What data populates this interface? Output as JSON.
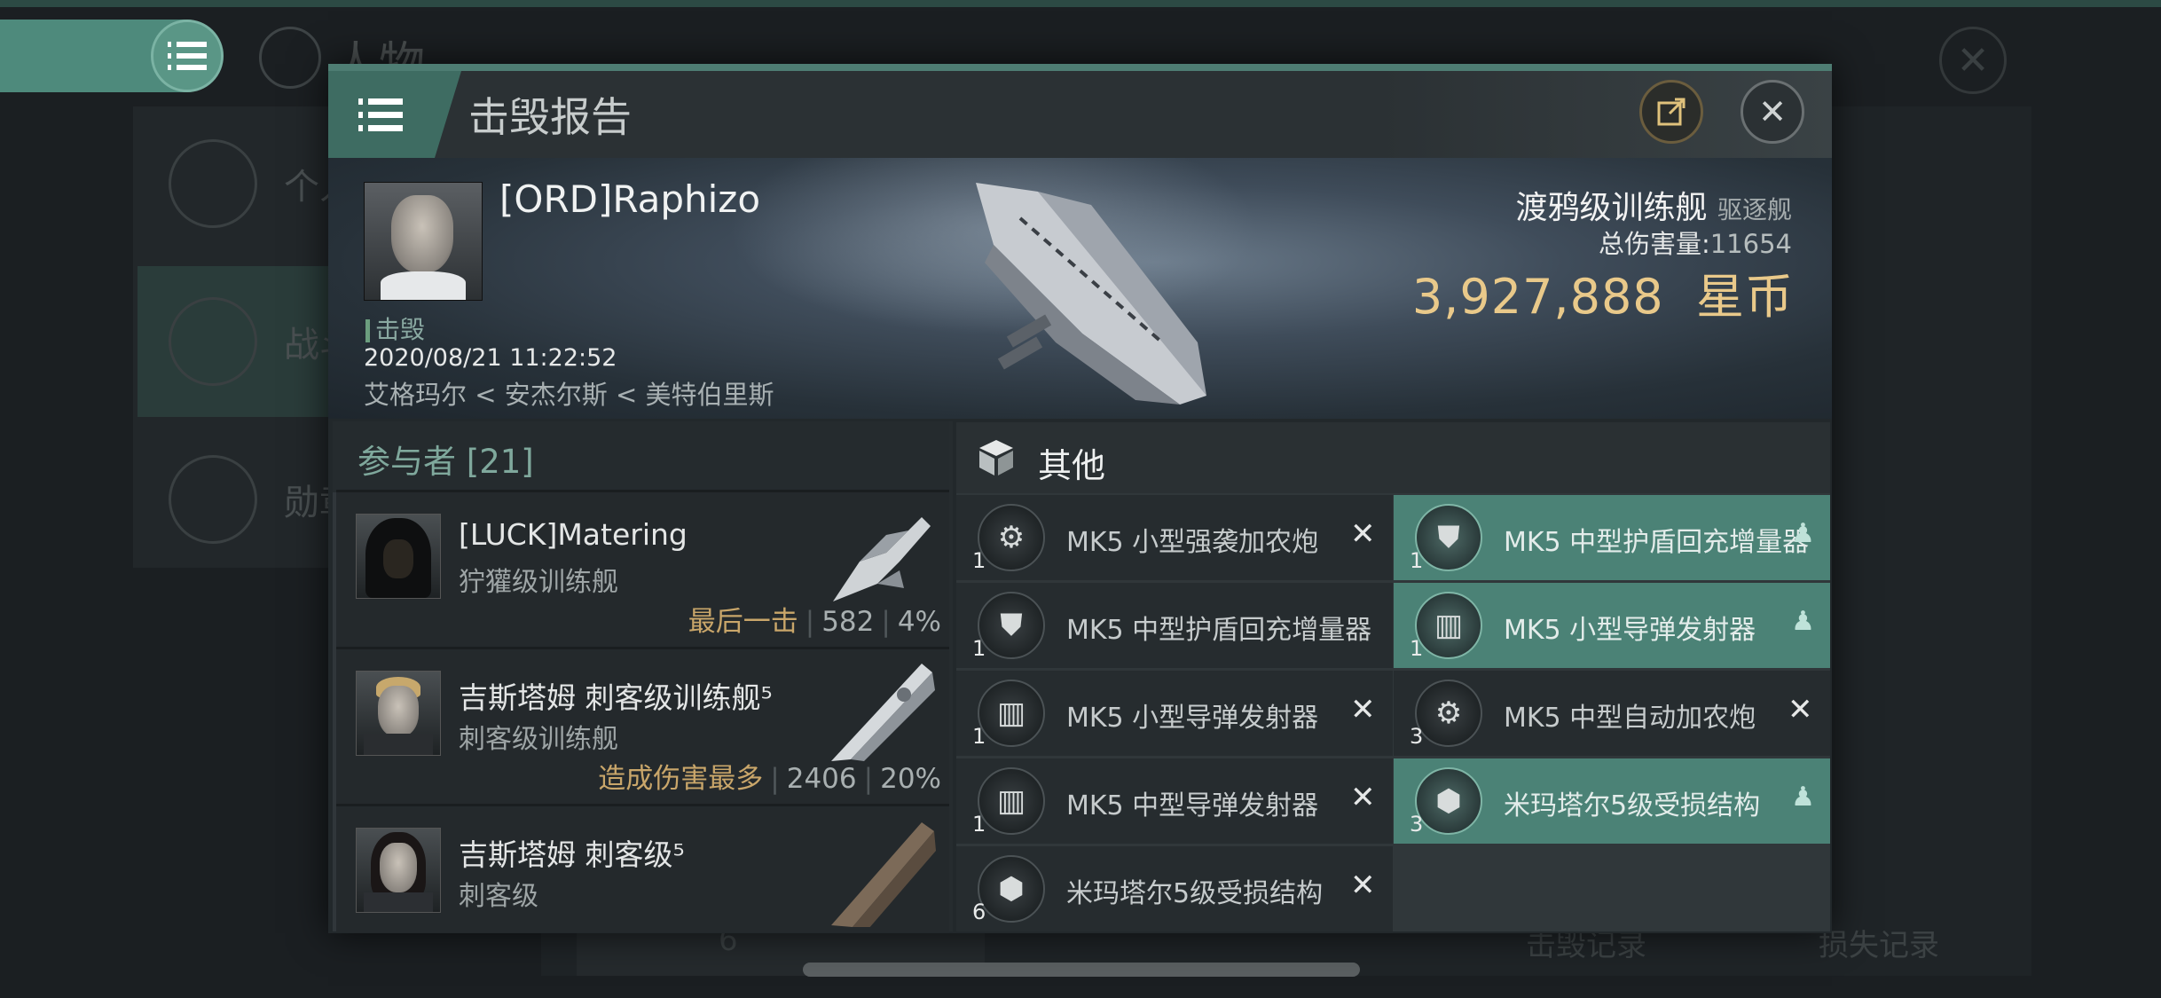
{
  "background": {
    "title": "人物",
    "side_items": [
      "个人",
      "战斗",
      "勋章"
    ],
    "bottom": {
      "count": "6",
      "kills": "击毁记录",
      "losses": "损失记录"
    }
  },
  "dialog": {
    "title": "击毁报告",
    "victim": {
      "name": "[ORD]Raphizo",
      "tag": "击毁",
      "date": "2020/08/21 11:22:52",
      "location": "艾格玛尔 < 安杰尔斯 < 美特伯里斯"
    },
    "ship": {
      "name": "渡鸦级训练舰",
      "class": "驱逐舰",
      "damage_label": "总伤害量:",
      "damage_value": "11654",
      "value": "3,927,888",
      "currency": "星币"
    },
    "participants": {
      "title": "参与者 [21]",
      "rows": [
        {
          "name": "[LUCK]Matering",
          "ship": "狞獾级训练舰",
          "label": "最后一击",
          "damage": "582",
          "percent": "4%"
        },
        {
          "name": "吉斯塔姆 刺客级训练舰⁵",
          "ship": "刺客级训练舰",
          "label": "造成伤害最多",
          "damage": "2406",
          "percent": "20%"
        },
        {
          "name": "吉斯塔姆 刺客级⁵",
          "ship": "刺客级",
          "label": "",
          "damage": "",
          "percent": ""
        }
      ]
    },
    "items": {
      "title": "其他",
      "left": [
        {
          "name": "MK5 小型强袭加农炮",
          "qty": "1",
          "icon": "cannon-icon"
        },
        {
          "name": "MK5 中型护盾回充增量器",
          "qty": "1",
          "icon": "shield-icon"
        },
        {
          "name": "MK5 小型导弹发射器",
          "qty": "1",
          "icon": "launcher-icon"
        },
        {
          "name": "MK5 中型导弹发射器",
          "qty": "1",
          "icon": "launcher-icon"
        },
        {
          "name": "米玛塔尔5级受损结构",
          "qty": "6",
          "icon": "structure-icon"
        }
      ],
      "right": [
        {
          "name": "MK5 中型护盾回充增量器",
          "qty": "1",
          "icon": "shield-icon",
          "highlight": true
        },
        {
          "name": "MK5 小型导弹发射器",
          "qty": "1",
          "icon": "launcher-icon",
          "highlight": true
        },
        {
          "name": "MK5 中型自动加农炮",
          "qty": "3",
          "icon": "cannon-icon",
          "highlight": false
        },
        {
          "name": "米玛塔尔5级受损结构",
          "qty": "3",
          "icon": "structure-icon",
          "highlight": true
        }
      ]
    }
  }
}
